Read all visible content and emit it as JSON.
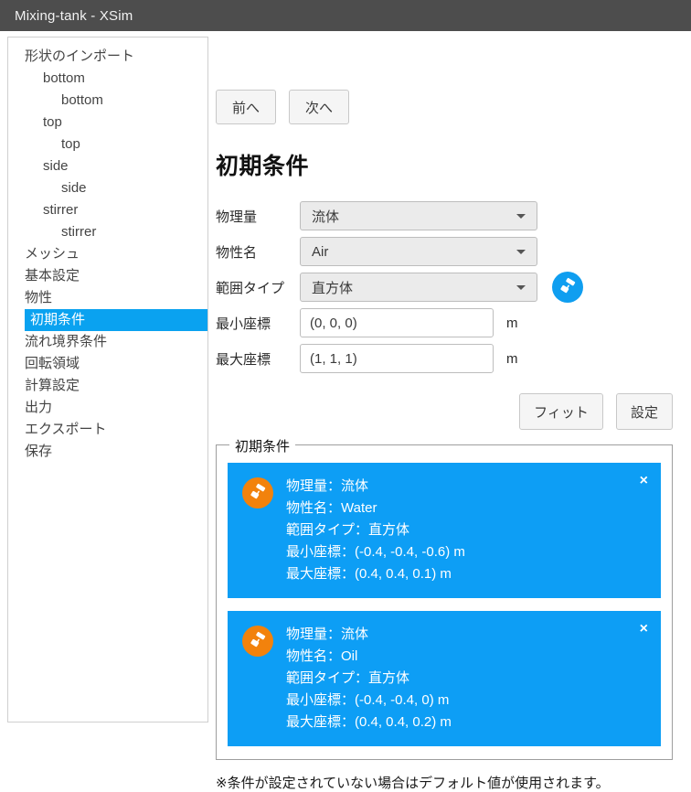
{
  "window": {
    "title": "Mixing-tank - XSim",
    "titlebar_color": "#4d4d4d"
  },
  "sidebar": {
    "items": [
      {
        "label": "形状のインポート",
        "depth": 0,
        "selected": false
      },
      {
        "label": "bottom",
        "depth": 1,
        "selected": false
      },
      {
        "label": "bottom",
        "depth": 2,
        "selected": false
      },
      {
        "label": "top",
        "depth": 1,
        "selected": false
      },
      {
        "label": "top",
        "depth": 2,
        "selected": false
      },
      {
        "label": "side",
        "depth": 1,
        "selected": false
      },
      {
        "label": "side",
        "depth": 2,
        "selected": false
      },
      {
        "label": "stirrer",
        "depth": 1,
        "selected": false
      },
      {
        "label": "stirrer",
        "depth": 2,
        "selected": false
      },
      {
        "label": "メッシュ",
        "depth": 0,
        "selected": false
      },
      {
        "label": "基本設定",
        "depth": 0,
        "selected": false
      },
      {
        "label": "物性",
        "depth": 0,
        "selected": false
      },
      {
        "label": "初期条件",
        "depth": 0,
        "selected": true
      },
      {
        "label": "流れ境界条件",
        "depth": 0,
        "selected": false
      },
      {
        "label": "回転領域",
        "depth": 0,
        "selected": false
      },
      {
        "label": "計算設定",
        "depth": 0,
        "selected": false
      },
      {
        "label": "出力",
        "depth": 0,
        "selected": false
      },
      {
        "label": "エクスポート",
        "depth": 0,
        "selected": false
      },
      {
        "label": "保存",
        "depth": 0,
        "selected": false
      }
    ],
    "selected_color": "#0aa2f0"
  },
  "main": {
    "nav": {
      "prev_label": "前へ",
      "next_label": "次へ"
    },
    "page_title": "初期条件",
    "form": {
      "rows": [
        {
          "label": "物理量",
          "kind": "select",
          "value": "流体"
        },
        {
          "label": "物性名",
          "kind": "select",
          "value": "Air"
        },
        {
          "label": "範囲タイプ",
          "kind": "select",
          "value": "直方体"
        },
        {
          "label": "最小座標",
          "kind": "text",
          "value": "(0, 0, 0)",
          "unit": "m"
        },
        {
          "label": "最大座標",
          "kind": "text",
          "value": "(1, 1, 1)",
          "unit": "m"
        }
      ],
      "paint_badge_color": "#0f9ef0"
    },
    "actions": {
      "fit_label": "フィット",
      "set_label": "設定"
    },
    "group": {
      "legend": "初期条件",
      "cards": [
        {
          "icon_color": "#f2820c",
          "close_label": "×",
          "lines": [
            "物理量：流体",
            "物性名：Water",
            "範囲タイプ：直方体",
            "最小座標：(-0.4, -0.4, -0.6) m",
            "最大座標：(0.4, 0.4, 0.1) m"
          ]
        },
        {
          "icon_color": "#f2820c",
          "close_label": "×",
          "lines": [
            "物理量：流体",
            "物性名：Oil",
            "範囲タイプ：直方体",
            "最小座標：(-0.4, -0.4, 0) m",
            "最大座標：(0.4, 0.4, 0.2) m"
          ]
        }
      ],
      "card_color": "#0d9ef5"
    },
    "footnote": "※条件が設定されていない場合はデフォルト値が使用されます。"
  }
}
